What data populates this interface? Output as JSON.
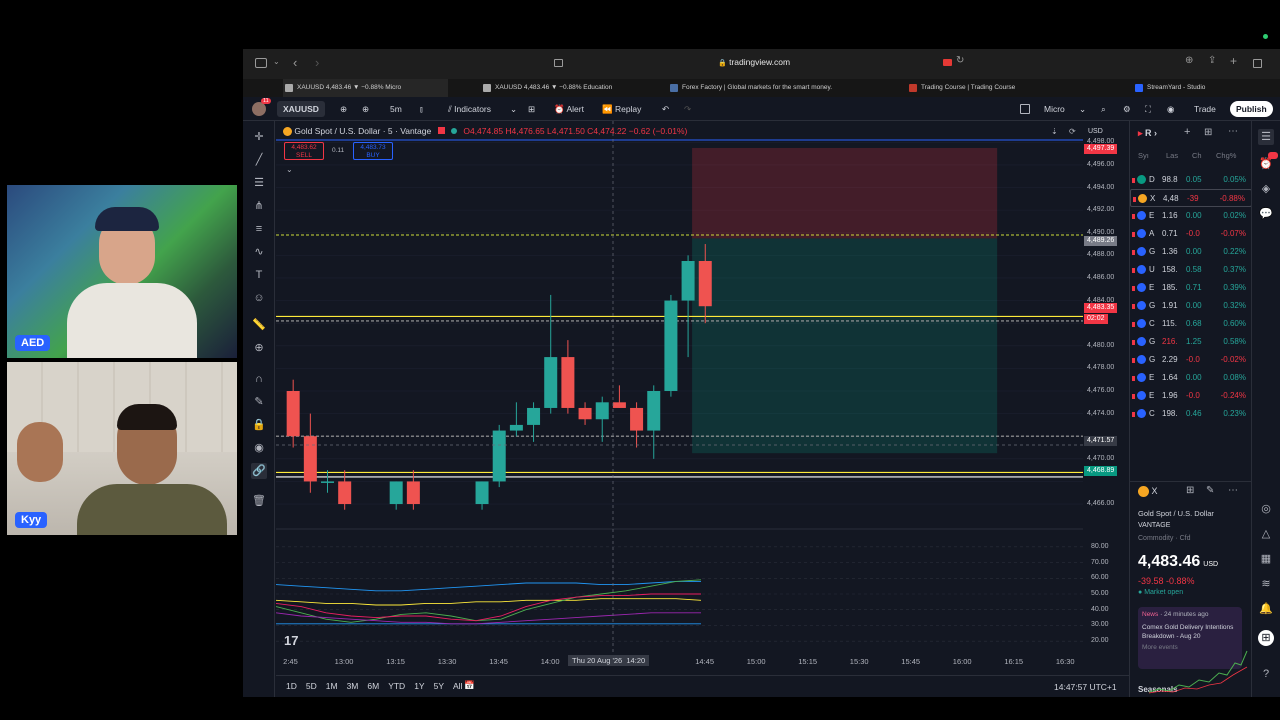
{
  "browser": {
    "url": "tradingview.com",
    "tabs": [
      {
        "label": "XAUUSD 4,483.46 ▼ −0.88% Micro",
        "color": "#aaaaaa"
      },
      {
        "label": "XAUUSD 4,483.46 ▼ −0.88% Education",
        "color": "#aaaaaa"
      },
      {
        "label": "Forex Factory | Global markets for the smart money.",
        "color": "#4a6fa5"
      },
      {
        "label": "Trading Course | Trading Course",
        "color": "#c0392b"
      },
      {
        "label": "StreamYard - Studio",
        "color": "#2962ff"
      }
    ]
  },
  "toolbar": {
    "symbol": "XAUUSD",
    "interval": "5m",
    "indicators": "Indicators",
    "alert": "Alert",
    "replay": "Replay",
    "layout": "Micro",
    "trade": "Trade",
    "publish": "Publish",
    "avatar_badge": "11"
  },
  "legend": {
    "title": "Gold Spot / U.S. Dollar · 5 · Vantage",
    "ohlc": "O4,474.85 H4,476.65 L4,471.50 C4,474.22 −0.62 (−0.01%)",
    "sell_price": "4,483.62",
    "sell_label": "SELL",
    "spread": "0.11",
    "buy_price": "4,483.73",
    "buy_label": "BUY",
    "currency": "USD"
  },
  "price_axis": {
    "labels": [
      "4,498.00",
      "4,496.00",
      "4,494.00",
      "4,492.00",
      "4,490.00",
      "4,488.00",
      "4,486.00",
      "4,484.00",
      "4,480.00",
      "4,478.00",
      "4,476.00",
      "4,474.00",
      "4,470.00",
      "4,466.00"
    ],
    "tags": [
      {
        "text": "4,497.39",
        "color": "#f23645"
      },
      {
        "text": "4,489.26",
        "color": "#787b86"
      },
      {
        "text": "4,483.35",
        "color": "#f23645"
      },
      {
        "text": "02:02",
        "color": "#f23645"
      },
      {
        "text": "4,471.57",
        "color": "#363a45"
      },
      {
        "text": "4,468.89",
        "color": "#089981"
      }
    ],
    "osc_labels": [
      "80.00",
      "70.00",
      "60.00",
      "50.00",
      "40.00",
      "30.00",
      "20.00"
    ]
  },
  "time_axis": {
    "labels": [
      "2:45",
      "13:00",
      "13:15",
      "13:30",
      "13:45",
      "14:00",
      "14:45",
      "15:00",
      "15:15",
      "15:30",
      "15:45",
      "16:00",
      "16:15",
      "16:30"
    ],
    "cursor_label": "Thu 20 Aug '26  14:20"
  },
  "bottom": {
    "ranges": [
      "1D",
      "5D",
      "1M",
      "3M",
      "6M",
      "YTD",
      "1Y",
      "5Y",
      "All"
    ],
    "clock": "14:47:57 UTC+1"
  },
  "watchlist": {
    "title": "R",
    "columns": [
      "Syı",
      "Las",
      "Ch",
      "Chg%"
    ],
    "rows": [
      {
        "sym": "D",
        "last": "98.8",
        "chg": "0.05",
        "pct": "0.05%",
        "up": true,
        "icon": "#089981"
      },
      {
        "sym": "X",
        "last": "4,48",
        "chg": "-39",
        "pct": "-0.88%",
        "up": false,
        "icon": "#f5a623"
      },
      {
        "sym": "E",
        "last": "1.16",
        "chg": "0.00",
        "pct": "0.02%",
        "up": true,
        "icon": "#2962ff"
      },
      {
        "sym": "A",
        "last": "0.71",
        "chg": "-0.0",
        "pct": "-0.07%",
        "up": false,
        "icon": "#2962ff"
      },
      {
        "sym": "G",
        "last": "1.36",
        "chg": "0.00",
        "pct": "0.22%",
        "up": true,
        "icon": "#2962ff"
      },
      {
        "sym": "U",
        "last": "158.",
        "chg": "0.58",
        "pct": "0.37%",
        "up": true,
        "icon": "#2962ff"
      },
      {
        "sym": "E",
        "last": "185.",
        "chg": "0.71",
        "pct": "0.39%",
        "up": true,
        "icon": "#2962ff"
      },
      {
        "sym": "G",
        "last": "1.91",
        "chg": "0.00",
        "pct": "0.32%",
        "up": true,
        "icon": "#2962ff"
      },
      {
        "sym": "C",
        "last": "115.",
        "chg": "0.68",
        "pct": "0.60%",
        "up": true,
        "icon": "#2962ff"
      },
      {
        "sym": "G",
        "last": "216.",
        "chg": "1.25",
        "pct": "0.58%",
        "up": true,
        "icon": "#2962ff"
      },
      {
        "sym": "G",
        "last": "2.29",
        "chg": "-0.0",
        "pct": "-0.02%",
        "up": false,
        "icon": "#2962ff"
      },
      {
        "sym": "E",
        "last": "1.64",
        "chg": "0.00",
        "pct": "0.08%",
        "up": true,
        "icon": "#2962ff"
      },
      {
        "sym": "E",
        "last": "1.96",
        "chg": "-0.0",
        "pct": "-0.24%",
        "up": false,
        "icon": "#2962ff"
      },
      {
        "sym": "C",
        "last": "198.",
        "chg": "0.46",
        "pct": "0.23%",
        "up": true,
        "icon": "#2962ff"
      }
    ]
  },
  "details": {
    "symbol": "X",
    "name": "Gold Spot / U.S. Dollar",
    "exchange": "VANTAGE",
    "category": "Commodity · Cfd",
    "price": "4,483.46",
    "currency": "USD",
    "change": "-39.58 -0.88%",
    "status": "Market open",
    "news_tag": "News",
    "news_time": "24 minutes ago",
    "news_title": "Comex Gold Delivery Intentions Breakdown - Aug 20",
    "more_events": "More events",
    "seasonals": "Seasonals"
  },
  "webcams": {
    "top_name": "AED",
    "bottom_name": "Kyy"
  },
  "colors": {
    "up": "#26a69a",
    "down": "#ef5350",
    "background": "#131722",
    "accent": "#2962ff"
  },
  "chart_data": {
    "type": "candlestick",
    "symbol": "XAUUSD",
    "timeframe": "5",
    "ylim": [
      4464,
      4500
    ],
    "candles": [
      {
        "t": "12:45",
        "o": 4476,
        "h": 4477,
        "l": 4471,
        "c": 4472
      },
      {
        "t": "12:50",
        "o": 4472,
        "h": 4474,
        "l": 4467,
        "c": 4468
      },
      {
        "t": "12:55",
        "o": 4468,
        "h": 4469,
        "l": 4467,
        "c": 4468
      },
      {
        "t": "13:00",
        "o": 4468,
        "h": 4469,
        "l": 4465.5,
        "c": 4466
      },
      {
        "t": "13:15",
        "o": 4466,
        "h": 4468,
        "l": 4465.5,
        "c": 4468
      },
      {
        "t": "13:20",
        "o": 4468,
        "h": 4469,
        "l": 4465.5,
        "c": 4466
      },
      {
        "t": "13:40",
        "o": 4466,
        "h": 4468,
        "l": 4465.5,
        "c": 4468
      },
      {
        "t": "13:45",
        "o": 4468,
        "h": 4473,
        "l": 4467.5,
        "c": 4472.5
      },
      {
        "t": "13:50",
        "o": 4472.5,
        "h": 4475,
        "l": 4472,
        "c": 4473
      },
      {
        "t": "13:55",
        "o": 4473,
        "h": 4475,
        "l": 4471.5,
        "c": 4474.5
      },
      {
        "t": "14:00",
        "o": 4474.5,
        "h": 4484.5,
        "l": 4474,
        "c": 4479
      },
      {
        "t": "14:05",
        "o": 4479,
        "h": 4480.5,
        "l": 4474,
        "c": 4474.5
      },
      {
        "t": "14:10",
        "o": 4474.5,
        "h": 4475,
        "l": 4473,
        "c": 4473.5
      },
      {
        "t": "14:15",
        "o": 4473.5,
        "h": 4475.5,
        "l": 4471.5,
        "c": 4475
      },
      {
        "t": "14:20",
        "o": 4475,
        "h": 4476.5,
        "l": 4474.5,
        "c": 4474.5
      },
      {
        "t": "14:25",
        "o": 4474.5,
        "h": 4475,
        "l": 4471,
        "c": 4472.5
      },
      {
        "t": "14:30",
        "o": 4472.5,
        "h": 4476.5,
        "l": 4470,
        "c": 4476
      },
      {
        "t": "14:35",
        "o": 4476,
        "h": 4484.5,
        "l": 4475.5,
        "c": 4484
      },
      {
        "t": "14:40",
        "o": 4484,
        "h": 4488,
        "l": 4479,
        "c": 4487.5
      },
      {
        "t": "14:45",
        "o": 4487.5,
        "h": 4489,
        "l": 4482,
        "c": 4483.5
      }
    ],
    "levels": [
      {
        "price": 4498.2,
        "color": "#2962ff"
      },
      {
        "price": 4489.8,
        "color": "#cddc39"
      },
      {
        "price": 4482.6,
        "color": "#ffeb3b"
      },
      {
        "price": 4482.2,
        "color": "#9e9e9e"
      },
      {
        "price": 4472.0,
        "color": "#9e9e9e"
      },
      {
        "price": 4468.8,
        "color": "#ffeb3b"
      },
      {
        "price": 4468.4,
        "color": "#ffffff"
      }
    ],
    "position": {
      "entry": 4489.5,
      "stop": 4497.5,
      "target": 4470.5,
      "t_start": "14:40",
      "t_end": "16:10"
    }
  }
}
